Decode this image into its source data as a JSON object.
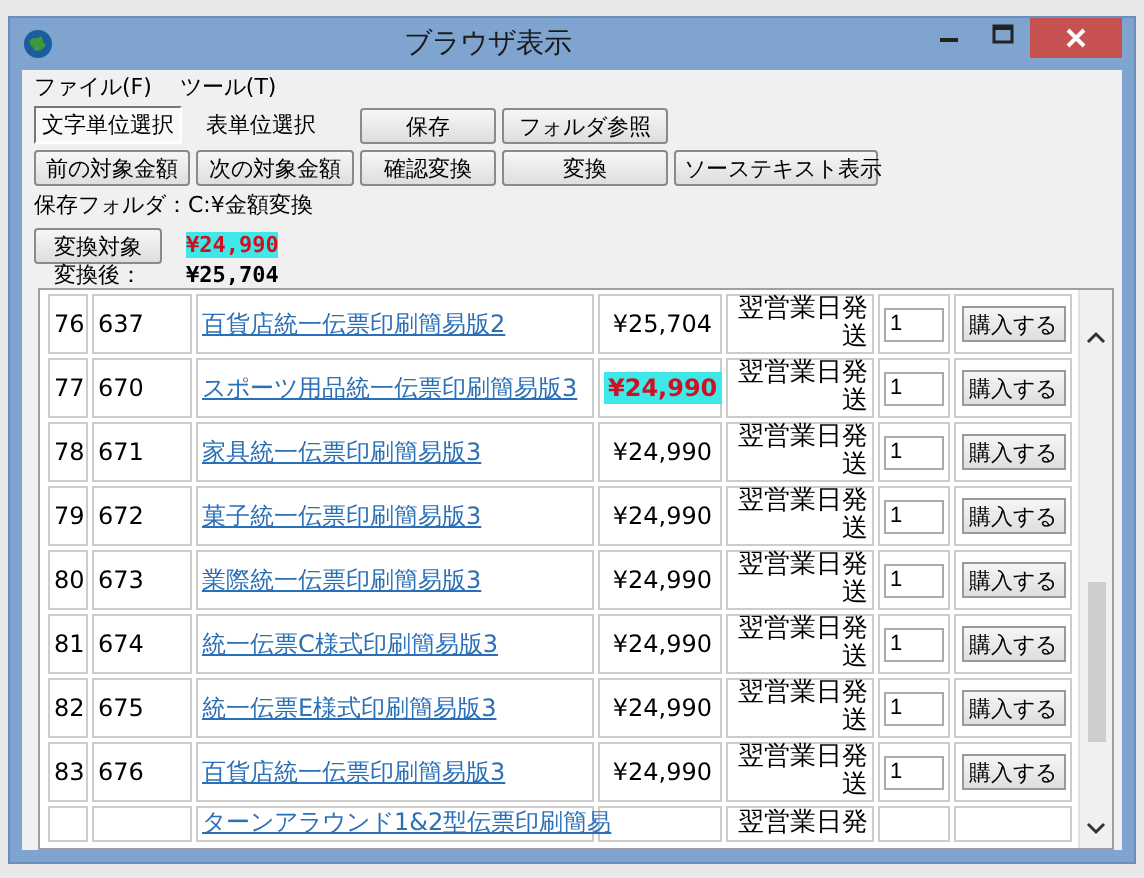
{
  "window": {
    "title": "ブラウザ表示"
  },
  "menu": [
    "ファイル(F)",
    "ツール(T)"
  ],
  "modes": [
    {
      "label": "文字単位選択",
      "selected": true
    },
    {
      "label": "表単位選択",
      "selected": false
    }
  ],
  "toolbar_row1": [
    "保存",
    "フォルダ参照"
  ],
  "toolbar_row2": [
    "前の対象金額",
    "次の対象金額",
    "確認変換",
    "変換",
    "ソーステキスト表示"
  ],
  "save_folder": "保存フォルダ：C:¥金額変換",
  "target": {
    "button": "変換対象",
    "value": "¥24,990"
  },
  "after": {
    "label": "変換後：",
    "value": "¥25,704"
  },
  "rows": [
    {
      "no": "76",
      "code": "637",
      "name": "百貨店統一伝票印刷簡易版2",
      "price": "¥25,704",
      "highlighted": false,
      "shipping": "翌営業日発送",
      "qty": "1",
      "buy": "購入する"
    },
    {
      "no": "77",
      "code": "670",
      "name": "スポーツ用品統一伝票印刷簡易版3",
      "price": "¥24,990",
      "highlighted": true,
      "shipping": "翌営業日発送",
      "qty": "1",
      "buy": "購入する"
    },
    {
      "no": "78",
      "code": "671",
      "name": "家具統一伝票印刷簡易版3",
      "price": "¥24,990",
      "highlighted": false,
      "shipping": "翌営業日発送",
      "qty": "1",
      "buy": "購入する"
    },
    {
      "no": "79",
      "code": "672",
      "name": "菓子統一伝票印刷簡易版3",
      "price": "¥24,990",
      "highlighted": false,
      "shipping": "翌営業日発送",
      "qty": "1",
      "buy": "購入する"
    },
    {
      "no": "80",
      "code": "673",
      "name": "業際統一伝票印刷簡易版3",
      "price": "¥24,990",
      "highlighted": false,
      "shipping": "翌営業日発送",
      "qty": "1",
      "buy": "購入する"
    },
    {
      "no": "81",
      "code": "674",
      "name": "統一伝票C様式印刷簡易版3",
      "price": "¥24,990",
      "highlighted": false,
      "shipping": "翌営業日発送",
      "qty": "1",
      "buy": "購入する"
    },
    {
      "no": "82",
      "code": "675",
      "name": "統一伝票E様式印刷簡易版3",
      "price": "¥24,990",
      "highlighted": false,
      "shipping": "翌営業日発送",
      "qty": "1",
      "buy": "購入する"
    },
    {
      "no": "83",
      "code": "676",
      "name": "百貨店統一伝票印刷簡易版3",
      "price": "¥24,990",
      "highlighted": false,
      "shipping": "翌営業日発送",
      "qty": "1",
      "buy": "購入する"
    },
    {
      "name": "ターンアラウンド1&2型伝票印刷簡易",
      "shipping": "翌営業日発"
    }
  ]
}
